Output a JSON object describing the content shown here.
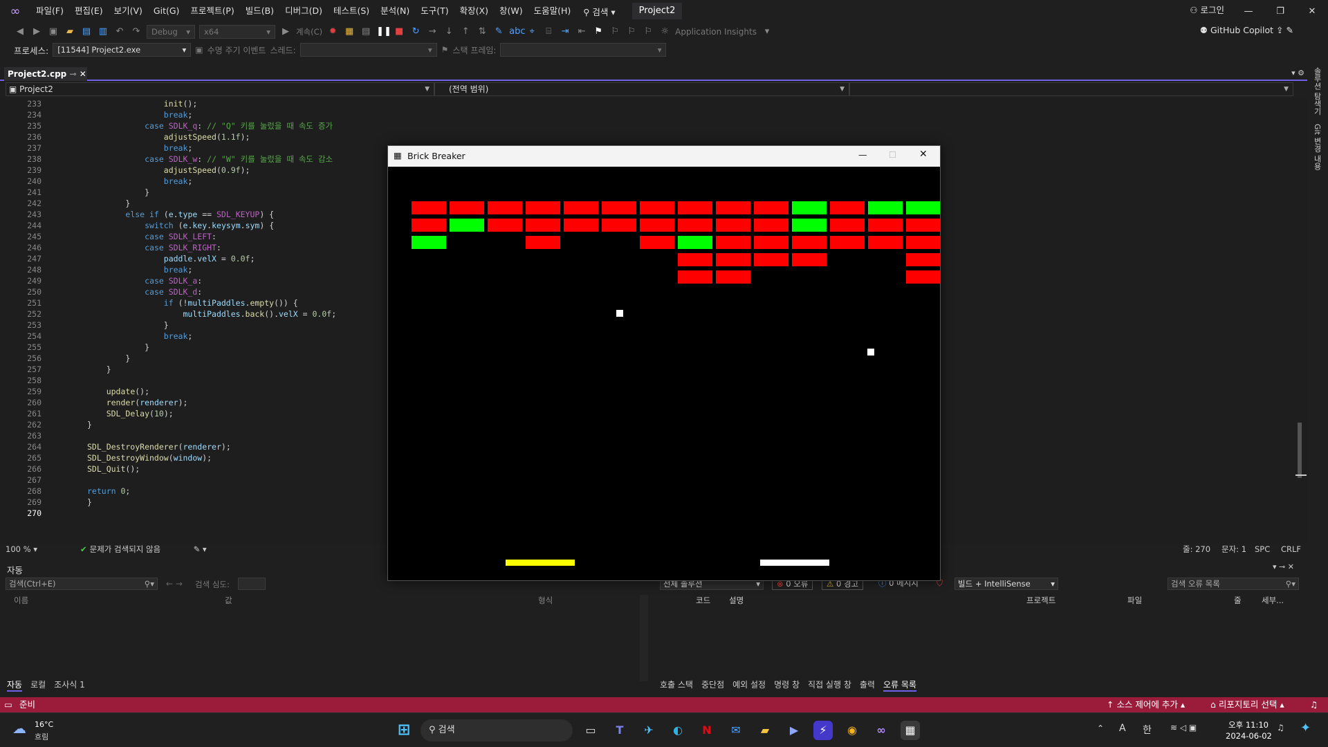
{
  "menubar": {
    "items": [
      "파일(F)",
      "편집(E)",
      "보기(V)",
      "Git(G)",
      "프로젝트(P)",
      "빌드(B)",
      "디버그(D)",
      "테스트(S)",
      "분석(N)",
      "도구(T)",
      "확장(X)",
      "창(W)",
      "도움말(H)"
    ],
    "search_label": "검색",
    "solution_name": "Project2",
    "login_label": "로그인"
  },
  "toolbar": {
    "config": "Debug",
    "platform": "x64",
    "continue_label": "계속(C)",
    "app_insights": "Application Insights",
    "copilot": "GitHub Copilot"
  },
  "procbar": {
    "process_label": "프로세스:",
    "process_value": "[11544] Project2.exe",
    "lifecycle_label": "수명 주기 이벤트",
    "thread_label": "스레드:",
    "stackframe_label": "스택 프레임:"
  },
  "editor": {
    "tab_name": "Project2.cpp",
    "project_combo": "Project2",
    "scope_combo": "(전역 범위)",
    "zoom": "100 %",
    "issues": "문제가 검색되지 않음",
    "line_info": "줄: 270",
    "col_info": "문자: 1",
    "spc": "SPC",
    "crlf": "CRLF",
    "line_numbers": [
      "233",
      "234",
      "235",
      "236",
      "237",
      "238",
      "239",
      "240",
      "241",
      "242",
      "243",
      "244",
      "245",
      "246",
      "247",
      "248",
      "249",
      "250",
      "251",
      "252",
      "253",
      "254",
      "255",
      "256",
      "257",
      "258",
      "259",
      "260",
      "261",
      "262",
      "263",
      "264",
      "265",
      "266",
      "267",
      "268",
      "269",
      "270"
    ]
  },
  "bottom_left": {
    "title": "자동",
    "search_placeholder": "검색(Ctrl+E)",
    "search_depth": "검색 심도:",
    "col_name": "이름",
    "col_value": "값",
    "col_type": "형식",
    "tabs": [
      "자동",
      "로컬",
      "조사식 1"
    ]
  },
  "bottom_right": {
    "scope": "전체 솔루션",
    "errors": "0 오류",
    "warnings": "0 경고",
    "messages": "0 메시지",
    "build_filter": "빌드 + IntelliSense",
    "search_placeholder": "검색 오류 목록",
    "cols": [
      "코드",
      "설명",
      "프로젝트",
      "파일",
      "줄",
      "세부..."
    ],
    "tabs": [
      "호출 스택",
      "중단점",
      "예외 설정",
      "명령 창",
      "직접 실행 창",
      "출력",
      "오류 목록"
    ]
  },
  "statusbar": {
    "ready": "준비",
    "source_control": "소스 제어에 추가",
    "repo": "리포지토리 선택"
  },
  "taskbar": {
    "weather_temp": "16°C",
    "weather_desc": "흐림",
    "search_label": "검색",
    "time": "오후 11:10",
    "date": "2024-06-02",
    "ime_a": "A",
    "ime_han": "한"
  },
  "game": {
    "title": "Brick Breaker",
    "bricks": [
      [
        1,
        1,
        1,
        1,
        1,
        1,
        1,
        1,
        1,
        1,
        2,
        1,
        2,
        2
      ],
      [
        1,
        2,
        1,
        1,
        1,
        1,
        1,
        1,
        1,
        1,
        2,
        1,
        1,
        1
      ],
      [
        2,
        0,
        0,
        1,
        0,
        0,
        1,
        2,
        1,
        1,
        1,
        1,
        1,
        1
      ],
      [
        0,
        0,
        0,
        0,
        0,
        0,
        0,
        1,
        1,
        1,
        1,
        0,
        0,
        1
      ],
      [
        0,
        0,
        0,
        0,
        0,
        0,
        0,
        1,
        1,
        0,
        0,
        0,
        0,
        1
      ]
    ],
    "colors": {
      "red": "#ff0000",
      "green": "#00ff00",
      "yellow": "#ffff00",
      "white": "#ffffff"
    }
  }
}
